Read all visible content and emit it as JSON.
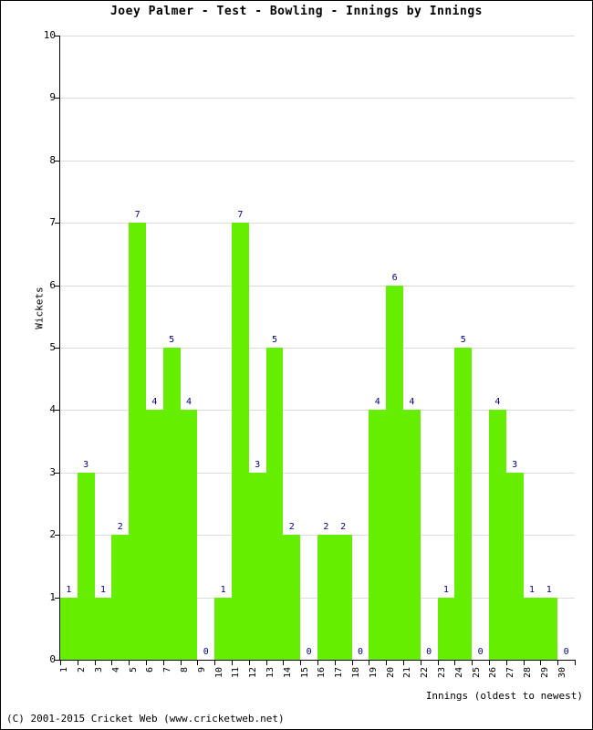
{
  "chart_data": {
    "type": "bar",
    "title": "Joey Palmer - Test - Bowling - Innings by Innings",
    "xlabel": "Innings (oldest to newest)",
    "ylabel": "Wickets",
    "ylim": [
      0,
      10
    ],
    "yticks": [
      0,
      1,
      2,
      3,
      4,
      5,
      6,
      7,
      8,
      9,
      10
    ],
    "grid": true,
    "legend": "none",
    "bar_color": "#66ee00",
    "label_color": "#000080",
    "categories": [
      "1",
      "2",
      "3",
      "4",
      "5",
      "6",
      "7",
      "8",
      "9",
      "10",
      "11",
      "12",
      "13",
      "14",
      "15",
      "16",
      "17",
      "18",
      "19",
      "20",
      "21",
      "22",
      "23",
      "24",
      "25",
      "26",
      "27",
      "28",
      "29",
      "30"
    ],
    "values": [
      1,
      3,
      1,
      2,
      7,
      4,
      5,
      4,
      0,
      1,
      7,
      3,
      5,
      2,
      0,
      2,
      2,
      0,
      4,
      6,
      4,
      0,
      1,
      5,
      0,
      4,
      3,
      1,
      1,
      0
    ],
    "point_labels": [
      "1",
      "3",
      "1",
      "2",
      "7",
      "4",
      "5",
      "4",
      "0",
      "1",
      "7",
      "3",
      "5",
      "2",
      "0",
      "2",
      "2",
      "0",
      "4",
      "6",
      "4",
      "0",
      "1",
      "5",
      "0",
      "4",
      "3",
      "1",
      "1",
      "0"
    ]
  },
  "footer": {
    "copyright": "(C) 2001-2015 Cricket Web (www.cricketweb.net)"
  }
}
